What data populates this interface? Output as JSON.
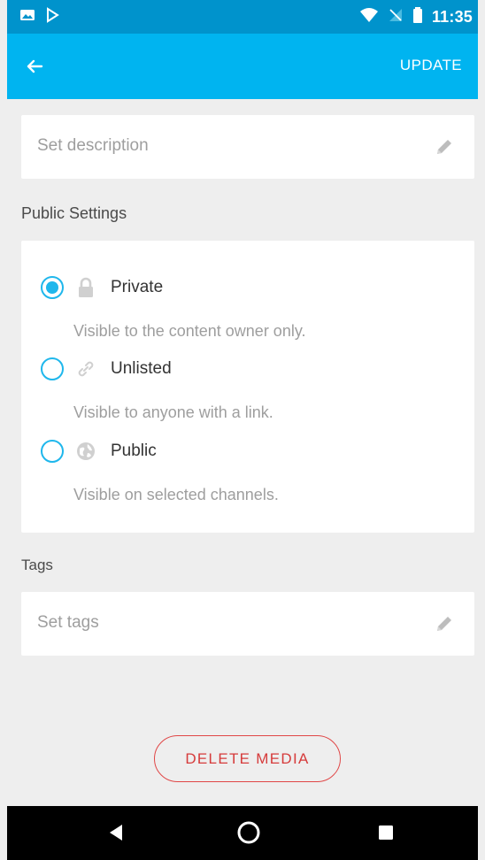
{
  "status_bar": {
    "time": "11:35",
    "icons": [
      "image-icon",
      "play-store-icon",
      "wifi-icon",
      "no-signal-icon",
      "battery-icon"
    ]
  },
  "toolbar": {
    "back_icon": "back-arrow-icon",
    "update_label": "UPDATE"
  },
  "description": {
    "placeholder": "Set description",
    "edit_icon": "pencil-icon"
  },
  "public_settings": {
    "title": "Public Settings",
    "selected": "Private",
    "options": [
      {
        "label": "Private",
        "description": "Visible to the content owner only.",
        "icon": "lock-icon"
      },
      {
        "label": "Unlisted",
        "description": "Visible to anyone with a link.",
        "icon": "link-icon"
      },
      {
        "label": "Public",
        "description": "Visible on selected channels.",
        "icon": "globe-icon"
      }
    ]
  },
  "tags": {
    "title": "Tags",
    "placeholder": "Set tags",
    "edit_icon": "pencil-icon"
  },
  "actions": {
    "delete_label": "DELETE MEDIA"
  },
  "navigation_bar": {
    "icons": [
      "nav-back-icon",
      "nav-home-icon",
      "nav-recents-icon"
    ]
  },
  "colors": {
    "status_bar": "#0093cc",
    "app_bar": "#00b4f0",
    "radio_active": "#1fb7ec",
    "delete": "#d63b3b",
    "background": "#eeeeee"
  }
}
